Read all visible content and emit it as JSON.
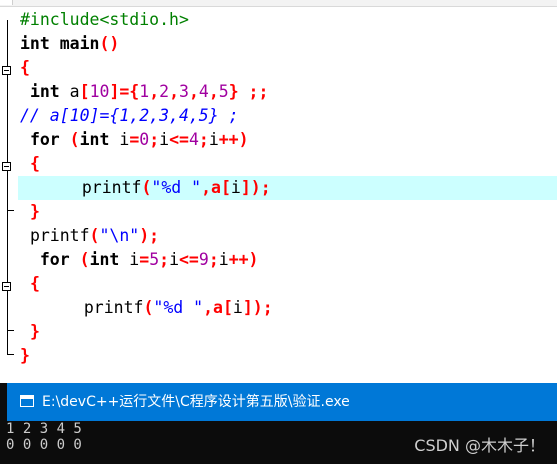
{
  "editor": {
    "tab_label": "",
    "code": {
      "l1_include": "#include<stdio.h>",
      "l2_kw": "int",
      "l2_name": " main",
      "l2_parens": "()",
      "l3_brace": "{",
      "l4_kw": "int",
      "l4_arr": " a",
      "l4_br1": "[",
      "l4_n10": "10",
      "l4_br2": "]",
      "l4_eq": "={",
      "l4_n1": "1",
      "l4_c1": ",",
      "l4_n2": "2",
      "l4_c2": ",",
      "l4_n3": "3",
      "l4_c3": ",",
      "l4_n4": "4",
      "l4_c4": ",",
      "l4_n5": "5",
      "l4_end": "} ;;",
      "l5_comment": "// a[10]={1,2,3,4,5} ;",
      "l6_kw_for": "for",
      "l6_open": " (",
      "l6_kw_int": "int",
      "l6_i": " i",
      "l6_eq": "=",
      "l6_n0": "0",
      "l6_semi1": ";",
      "l6_i2": "i",
      "l6_le": "<=",
      "l6_n4": "4",
      "l6_semi2": ";",
      "l6_i3": "i",
      "l6_inc": "++)",
      "l7_brace": "{",
      "l8_fn": "printf",
      "l8_open": "(",
      "l8_str": "\"%d \"",
      "l8_comma": ",a",
      "l8_br1": "[",
      "l8_i": "i",
      "l8_end": "]);",
      "l9_brace": "}",
      "l10_fn": "printf",
      "l10_open": "(",
      "l10_str": "\"\\n\"",
      "l10_end": ");",
      "l11_kw_for": "for",
      "l11_open": " (",
      "l11_kw_int": "int",
      "l11_i": " i",
      "l11_eq": "=",
      "l11_n5": "5",
      "l11_semi1": ";",
      "l11_i2": "i",
      "l11_le": "<=",
      "l11_n9": "9",
      "l11_semi2": ";",
      "l11_i3": "i",
      "l11_inc": "++)",
      "l12_brace": "{",
      "l13_fn": "printf",
      "l13_open": "(",
      "l13_str": "\"%d \"",
      "l13_comma": ",a",
      "l13_br1": "[",
      "l13_i": "i",
      "l13_end": "]);",
      "l14_brace": "}",
      "l15_brace": "}"
    },
    "colors": {
      "highlight_line": "#ccffff",
      "preprocessor": "#008000",
      "number": "#a000a0",
      "string": "#0000ff",
      "symbol": "#ff0000",
      "comment": "#0000ff"
    }
  },
  "console": {
    "title": "E:\\devC++运行文件\\C程序设计第五版\\验证.exe",
    "icon": "console-window-icon",
    "output_line1": "1 2 3 4 5",
    "output_line2": "0 0 0 0 0",
    "title_bar_color": "#0078d7",
    "background_color": "#0c0c0c"
  },
  "watermark": {
    "text": "CSDN @木木子！"
  }
}
